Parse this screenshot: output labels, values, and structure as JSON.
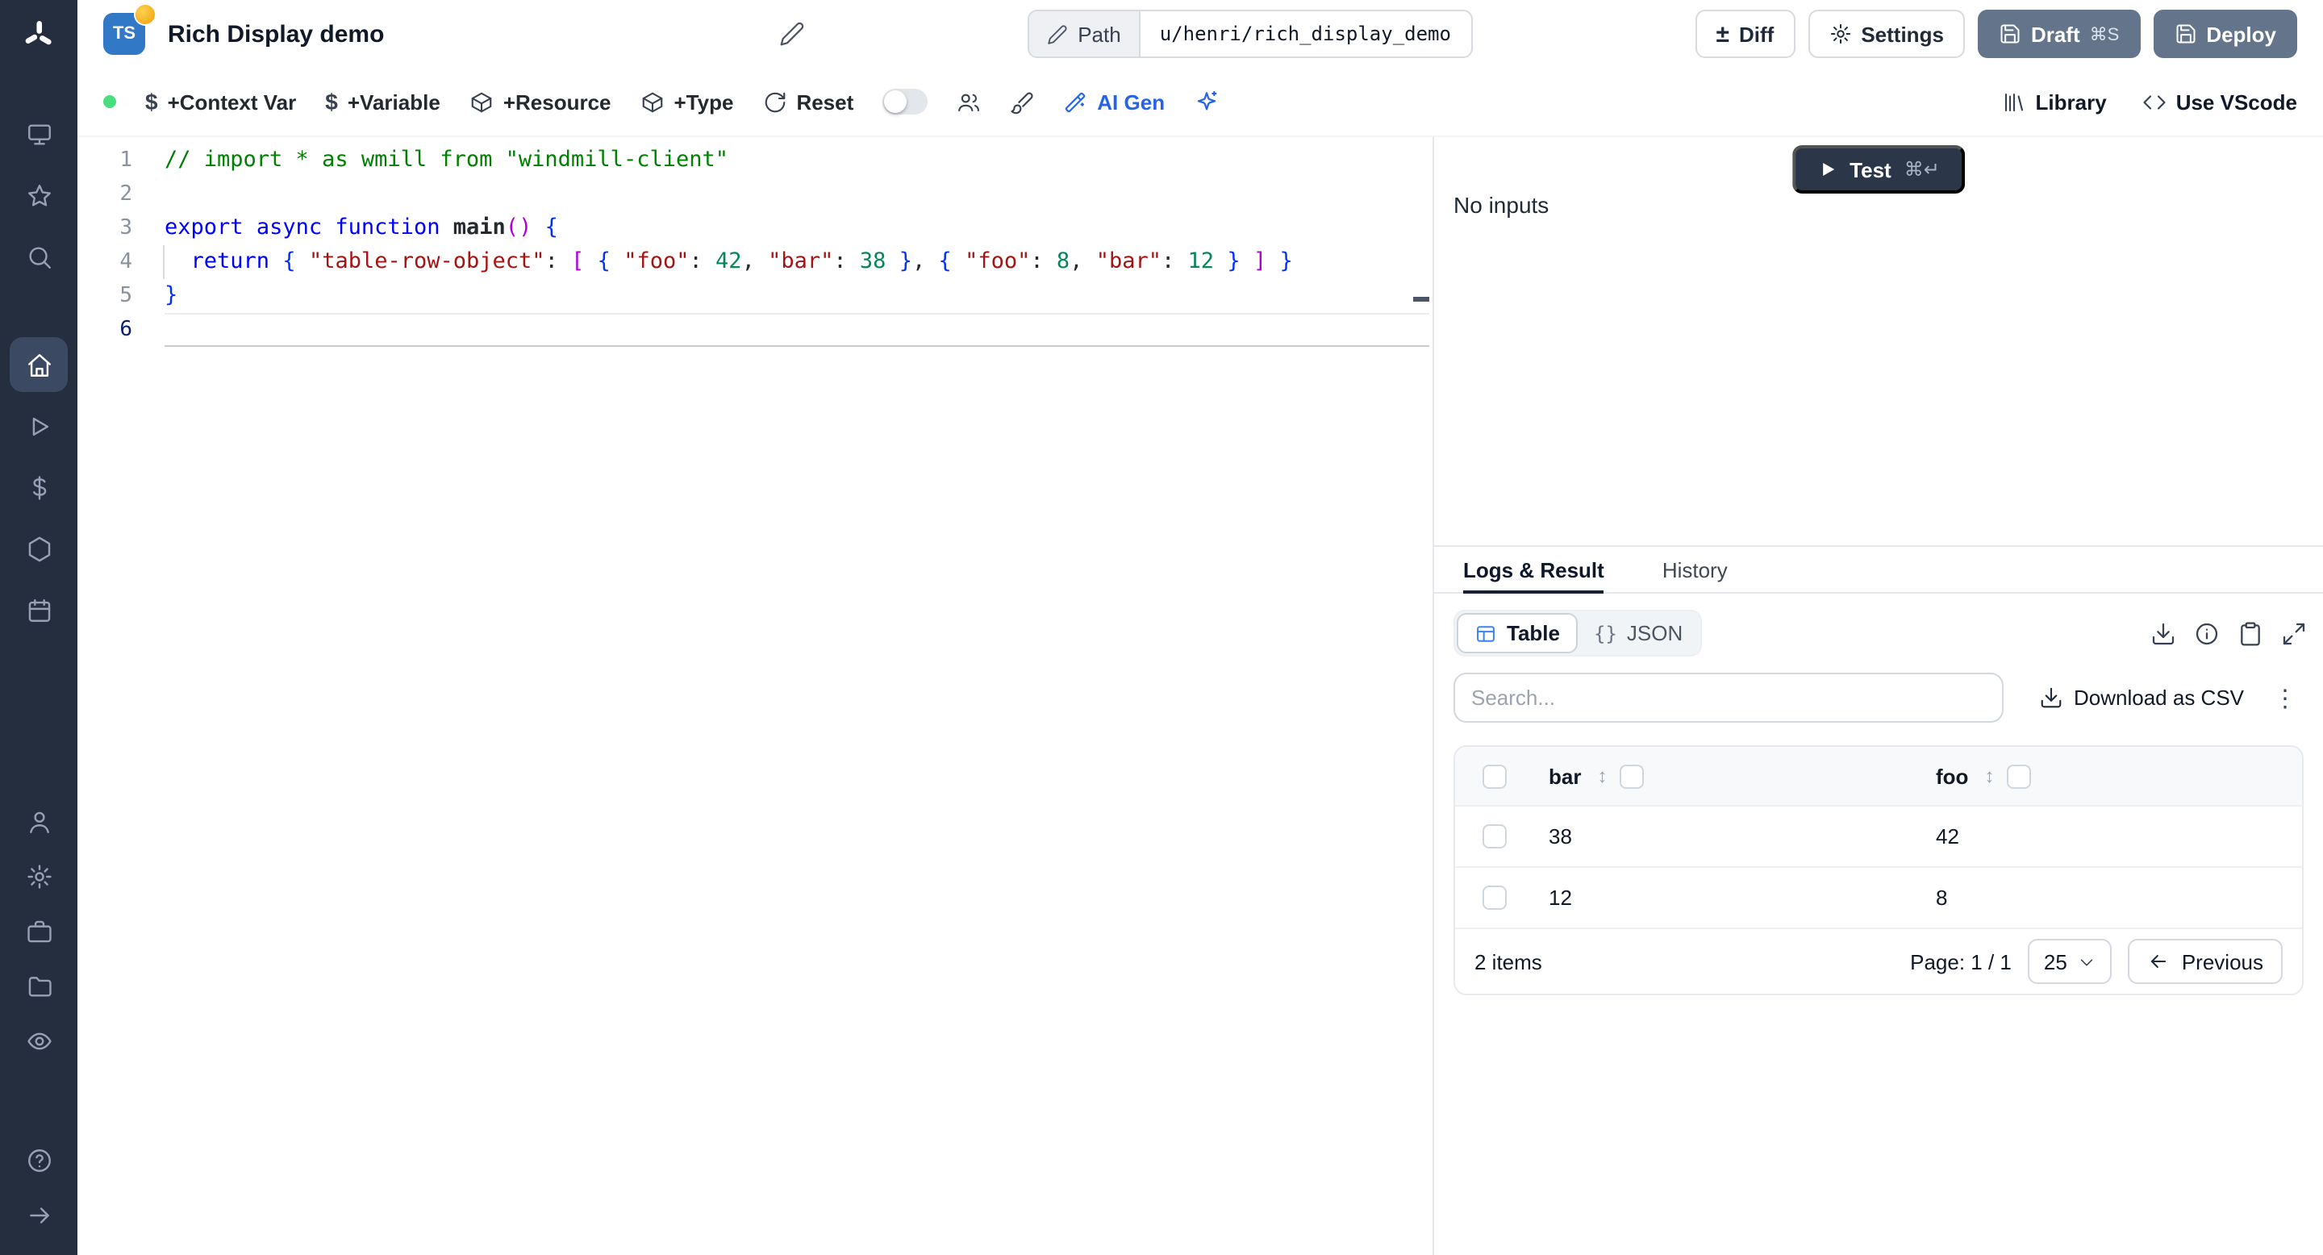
{
  "header": {
    "language_badge": "TS",
    "title": "Rich Display demo",
    "path_label": "Path",
    "path_value": "u/henri/rich_display_demo",
    "diff": "Diff",
    "settings": "Settings",
    "draft": "Draft",
    "draft_shortcut": "⌘S",
    "deploy": "Deploy"
  },
  "toolbar": {
    "context_var": "+Context Var",
    "variable": "+Variable",
    "resource": "+Resource",
    "type": "+Type",
    "reset": "Reset",
    "ai_gen": "AI Gen",
    "library": "Library",
    "use_vscode": "Use VScode"
  },
  "editor": {
    "lines": [
      {
        "n": "1",
        "toks": [
          [
            "// import * as wmill from \"windmill-client\"",
            "com"
          ]
        ]
      },
      {
        "n": "2",
        "toks": []
      },
      {
        "n": "3",
        "toks": [
          [
            "export",
            "kw"
          ],
          [
            " ",
            "pl"
          ],
          [
            "async",
            "kw"
          ],
          [
            " ",
            "pl"
          ],
          [
            "function",
            "kw"
          ],
          [
            " ",
            "pl"
          ],
          [
            "main",
            "fn"
          ],
          [
            "(",
            "p2"
          ],
          [
            ")",
            "p2"
          ],
          [
            " ",
            "pl"
          ],
          [
            "{",
            "p1"
          ]
        ]
      },
      {
        "n": "4",
        "guide": true,
        "toks": [
          [
            "  ",
            "pl"
          ],
          [
            "return",
            "kw"
          ],
          [
            " ",
            "pl"
          ],
          [
            "{",
            "p1"
          ],
          [
            " ",
            "pl"
          ],
          [
            "\"table-row-object\"",
            "str"
          ],
          [
            ": ",
            "pl"
          ],
          [
            "[",
            "p2"
          ],
          [
            " ",
            "pl"
          ],
          [
            "{",
            "p1"
          ],
          [
            " ",
            "pl"
          ],
          [
            "\"foo\"",
            "str"
          ],
          [
            ": ",
            "pl"
          ],
          [
            "42",
            "num"
          ],
          [
            ", ",
            "pl"
          ],
          [
            "\"bar\"",
            "str"
          ],
          [
            ": ",
            "pl"
          ],
          [
            "38",
            "num"
          ],
          [
            " ",
            "pl"
          ],
          [
            "}",
            "p1"
          ],
          [
            ", ",
            "pl"
          ],
          [
            "{",
            "p1"
          ],
          [
            " ",
            "pl"
          ],
          [
            "\"foo\"",
            "str"
          ],
          [
            ": ",
            "pl"
          ],
          [
            "8",
            "num"
          ],
          [
            ", ",
            "pl"
          ],
          [
            "\"bar\"",
            "str"
          ],
          [
            ": ",
            "pl"
          ],
          [
            "12",
            "num"
          ],
          [
            " ",
            "pl"
          ],
          [
            "}",
            "p1"
          ],
          [
            " ",
            "pl"
          ],
          [
            "]",
            "p2"
          ],
          [
            " ",
            "pl"
          ],
          [
            "}",
            "p1"
          ]
        ]
      },
      {
        "n": "5",
        "toks": [
          [
            "}",
            "p1"
          ]
        ]
      },
      {
        "n": "6",
        "current": true,
        "toks": []
      }
    ]
  },
  "inputs_panel": {
    "no_inputs": "No inputs",
    "test": "Test",
    "test_shortcut": "⌘↵"
  },
  "results_panel": {
    "tab_logs": "Logs & Result",
    "tab_history": "History",
    "view_table": "Table",
    "view_json": "JSON",
    "json_braces": "{}",
    "search_placeholder": "Search...",
    "download_csv": "Download as CSV",
    "table": {
      "columns": [
        "bar",
        "foo"
      ],
      "rows": [
        [
          "38",
          "42"
        ],
        [
          "12",
          "8"
        ]
      ],
      "items": "2 items",
      "page": "Page: 1 / 1",
      "page_size": "25",
      "previous": "Previous"
    }
  },
  "icons": {
    "sidebar": [
      "windmill-logo",
      "monitor",
      "star",
      "search",
      "home",
      "play",
      "dollar",
      "hexagon",
      "calendar",
      "user",
      "gear",
      "briefcase",
      "folder",
      "eye",
      "help-circle",
      "arrow-right"
    ],
    "sidebar_active": "home"
  },
  "colors": {
    "accent": "#2563eb",
    "slate_button": "#64748b",
    "dark_button": "#2b3648",
    "sidebar_bg": "#252e3f",
    "green_dot": "#4ade80",
    "ts_blue": "#3178c6"
  }
}
